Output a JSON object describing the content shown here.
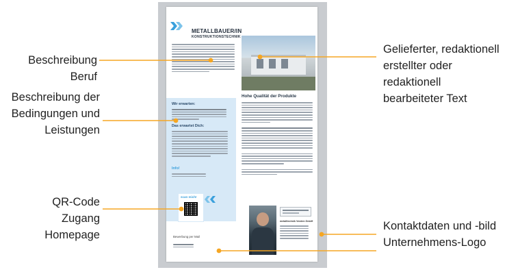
{
  "labels": {
    "job_description": "Beschreibung Beruf",
    "conditions_line1": "Beschreibung der",
    "conditions_line2": "Bedingungen und",
    "conditions_line3": "Leistungen",
    "qr_line1": "QR-Code",
    "qr_line2": "Zugang Homepage",
    "text_line1": "Gelieferter, redaktionell",
    "text_line2": "erstellter oder",
    "text_line3": "redaktionell",
    "text_line4": "bearbeiteter Text",
    "contact_line1": "Kontaktdaten und -bild",
    "contact_line2": "Unternehmens-Logo"
  },
  "flyer": {
    "title": "METALLBAUER/IN",
    "subtitle": "KONSTRUKTIONSTECHNIK",
    "section_expect": "Wir erwarten:",
    "section_offer": "Das erwartet Dich:",
    "section_info": "Info!",
    "main_heading": "Hohe Qualität der Produkte",
    "scan_label": "scan mich!",
    "apply_label": "Bewerbung per Mail",
    "company_name": "metalltechnik Veeden GmbH"
  },
  "colors": {
    "accent_orange": "#f5a623",
    "accent_blue": "#3aa0dc",
    "panel_blue": "#d7e9f7",
    "frame_gray": "#c9ccd0"
  }
}
